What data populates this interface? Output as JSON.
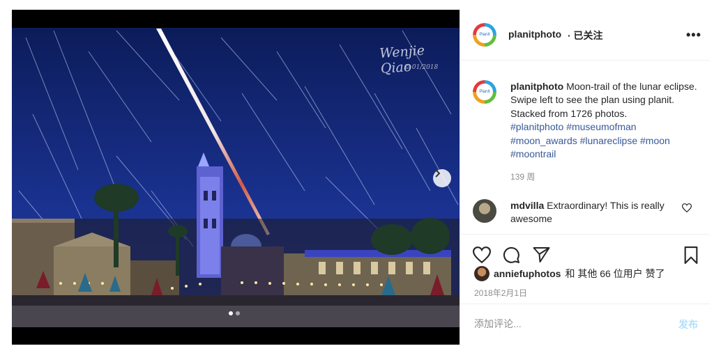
{
  "photo": {
    "signature_name": "Wenjie Qiao",
    "signature_date": "© 01/2018"
  },
  "header": {
    "username": "planitphoto",
    "follow_label": "· 已关注",
    "more_label": "•••"
  },
  "caption": {
    "username": "planitphoto",
    "text": "Moon-trail of the lunar eclipse. Swipe left to see the plan using planit. Stacked from 1726 photos.",
    "hashtags": [
      "#planitphoto",
      "#museumofman",
      "#moon_awards",
      "#lunareclipse",
      "#moon",
      "#moontrail"
    ],
    "time": "139 周"
  },
  "comment": {
    "username": "mdvilla",
    "text": "Extraordinary! This is really awesome"
  },
  "likes": {
    "username": "anniefuphotos",
    "rest": "和 其他 66 位用户 赞了"
  },
  "date": "2018年2月1日",
  "add_comment": {
    "placeholder": "添加评论...",
    "post_label": "发布"
  },
  "colors": {
    "link": "#385898",
    "post_button": "#b2dffc",
    "muted": "#8e8e8e"
  }
}
